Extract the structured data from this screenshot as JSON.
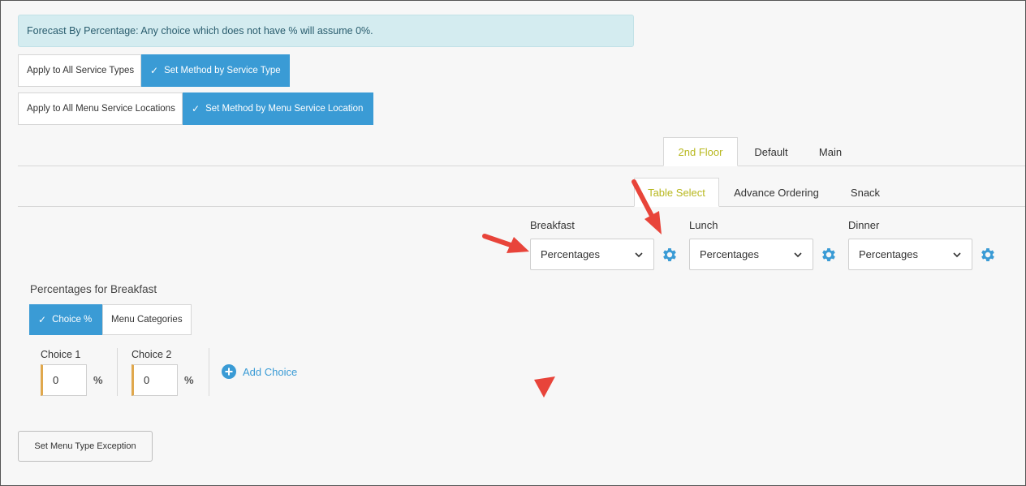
{
  "banner": {
    "text": "Forecast By Percentage: Any choice which does not have % will assume 0%."
  },
  "service_type_toggle": {
    "apply_all": "Apply to All Service Types",
    "set_method": "Set Method by Service Type"
  },
  "location_toggle": {
    "apply_all": "Apply to All Menu Service Locations",
    "set_method": "Set Method by Menu Service Location"
  },
  "location_tabs": [
    {
      "label": "2nd Floor",
      "active": true
    },
    {
      "label": "Default",
      "active": false
    },
    {
      "label": "Main",
      "active": false
    }
  ],
  "service_tabs": [
    {
      "label": "Table Select",
      "active": true
    },
    {
      "label": "Advance Ordering",
      "active": false
    },
    {
      "label": "Snack",
      "active": false
    }
  ],
  "meals": [
    {
      "label": "Breakfast",
      "method": "Percentages"
    },
    {
      "label": "Lunch",
      "method": "Percentages"
    },
    {
      "label": "Dinner",
      "method": "Percentages"
    }
  ],
  "percentages_section": {
    "title": "Percentages for Breakfast",
    "mode_choice": "Choice %",
    "mode_categories": "Menu Categories"
  },
  "choices": [
    {
      "label": "Choice 1",
      "value": "0",
      "unit": "%"
    },
    {
      "label": "Choice 2",
      "value": "0",
      "unit": "%"
    }
  ],
  "add_choice_label": "Add Choice",
  "exception_button": "Set Menu Type Exception",
  "colors": {
    "accent_blue": "#3a9bd5",
    "active_tab_text": "#b8b81f",
    "annotation_red": "#e8443a",
    "input_accent": "#e0a84d"
  }
}
